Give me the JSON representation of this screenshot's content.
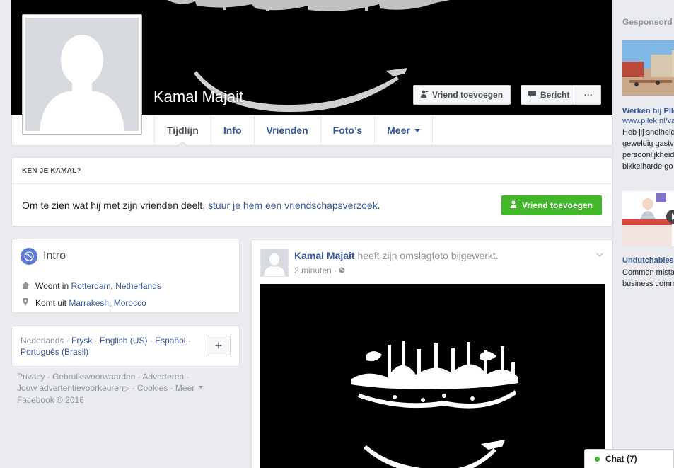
{
  "profile": {
    "name": "Kamal Majait",
    "add_friend_label": "Vriend toevoegen",
    "message_label": "Bericht",
    "more_label": "···"
  },
  "tabs": [
    {
      "label": "Tijdlijn"
    },
    {
      "label": "Info"
    },
    {
      "label": "Vrienden"
    },
    {
      "label": "Foto’s"
    },
    {
      "label": "Meer"
    }
  ],
  "know": {
    "header": "KEN JE KAMAL?",
    "text": "Om te zien wat hij met zijn vrienden deelt,",
    "link": "stuur je hem een vriendschapsverzoek",
    "text_end": ".",
    "button": "Vriend toevoegen"
  },
  "intro": {
    "title": "Intro",
    "lives_prefix": "Woont in",
    "lives_city": "Rotterdam",
    "lives_sep": ",",
    "lives_country": "Netherlands",
    "from_prefix": "Komt uit",
    "from_city": "Marrakesh",
    "from_sep": ",",
    "from_country": "Morocco"
  },
  "languages": {
    "current": "Nederlands",
    "sep": " · ",
    "items": [
      "Frysk",
      "English (US)",
      "Español"
    ],
    "item_last": "Português (Brasil)",
    "plus": "+"
  },
  "footer": {
    "line1": "Privacy · Gebruiksvoorwaarden · Adverteren ·",
    "line2a": "Jouw advertentievoorkeuren",
    "line2b": " · Cookies · Meer",
    "line3": "Facebook © 2016"
  },
  "post": {
    "author": "Kamal Majait",
    "action": "heeft zijn omslagfoto bijgewerkt.",
    "time": "2 minuten",
    "sep": "·"
  },
  "sidebar": {
    "heading": "Gesponsord",
    "ad1_title": "Werken bij Pllek",
    "ad1_url": "www.pllek.nl/va",
    "ad1_text": [
      "Heb jij snelheid",
      "geweldig gastv",
      "persoonlijkheid",
      "bikkelharde go"
    ],
    "ad2_title": "Undutchables",
    "ad2_text": [
      "Common mista",
      "business comm"
    ]
  },
  "chat": {
    "label": "Chat (7)"
  },
  "colors": {
    "link": "#365899",
    "green": "#42b72a",
    "background": "#e9ebee"
  }
}
